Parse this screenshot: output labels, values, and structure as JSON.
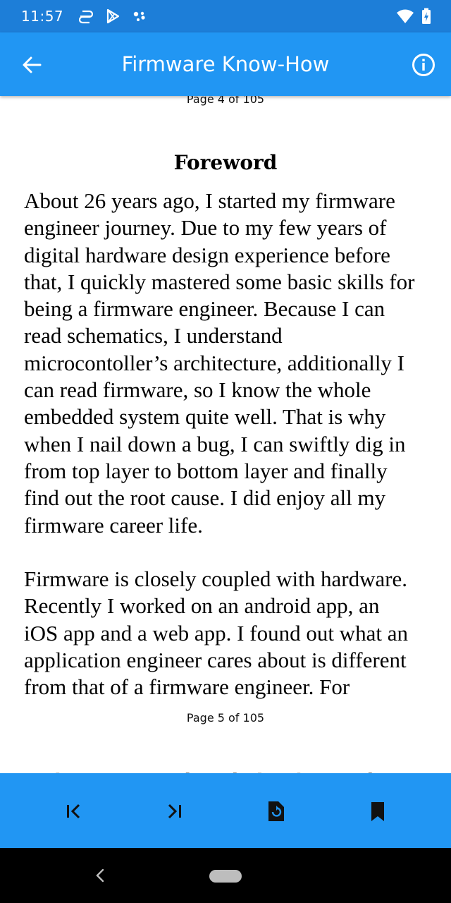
{
  "status_bar": {
    "time": "11:57",
    "left_icons": [
      "sync-icon",
      "play-store-icon",
      "assistant-dots-icon"
    ],
    "right_icons": [
      "wifi-icon",
      "battery-charging-icon"
    ]
  },
  "app_bar": {
    "title": "Firmware Know-How",
    "back_icon": "arrow-left-icon",
    "info_icon": "info-icon"
  },
  "reader": {
    "page_marker_top": "Page 4 of 105",
    "chapter_title": "Foreword",
    "paragraph1": [
      "About 26 years ago, I started my firmware",
      "engineer journey. Due to my few years of",
      "digital hardware design experience before",
      "that, I quickly mastered some basic skills for",
      "being a firmware engineer. Because I can",
      "read schematics, I understand",
      "microcontoller’s architecture, additionally I",
      "can read firmware, so I know the whole",
      "embedded system quite well. That is why",
      "when I nail down a bug, I can swiftly dig in",
      "from top layer to bottom layer and finally",
      "find out the root cause. I did enjoy all my",
      "firmware career life."
    ],
    "paragraph2": [
      "Firmware is closely coupled with hardware.",
      "Recently I worked on an android app, an",
      "iOS app and a web app. I found out what an",
      "application engineer cares about is different",
      "from that of a firmware engineer. For"
    ],
    "page_marker_mid": "Page 5 of 105",
    "paragraph3": [
      "application, it needs to deal with UI and OS"
    ]
  },
  "bottom_bar": {
    "buttons": [
      "first-page-icon",
      "last-page-icon",
      "rotate-page-icon",
      "bookmark-icon"
    ]
  },
  "nav_bar": {
    "buttons": [
      "nav-back-icon",
      "nav-home-pill"
    ]
  },
  "colors": {
    "status_bar": "#1d7ed8",
    "app_bar": "#2196f3",
    "bottom_bar": "#2196f3",
    "nav_bar": "#000000"
  }
}
